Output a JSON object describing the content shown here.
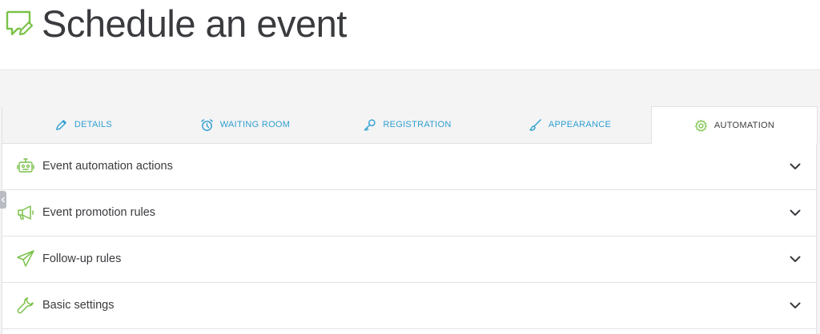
{
  "header": {
    "title": "Schedule an event",
    "logo_icon": "chat-edit-icon"
  },
  "tabs": [
    {
      "label": "DETAILS",
      "icon": "pencil-icon",
      "active": false
    },
    {
      "label": "WAITING ROOM",
      "icon": "alarm-clock-icon",
      "active": false
    },
    {
      "label": "REGISTRATION",
      "icon": "key-icon",
      "active": false
    },
    {
      "label": "APPEARANCE",
      "icon": "brush-icon",
      "active": false
    },
    {
      "label": "AUTOMATION",
      "icon": "gear-icon",
      "active": true
    }
  ],
  "panels": [
    {
      "label": "Event automation actions",
      "icon": "robot-icon"
    },
    {
      "label": "Event promotion rules",
      "icon": "megaphone-icon"
    },
    {
      "label": "Follow-up rules",
      "icon": "paper-plane-icon"
    },
    {
      "label": "Basic settings",
      "icon": "wrench-icon"
    }
  ],
  "colors": {
    "accent_green": "#7cc24a",
    "tab_link_blue": "#2e9fd0",
    "text_dark": "#3a3b3e",
    "background": "#f4f4f5"
  }
}
